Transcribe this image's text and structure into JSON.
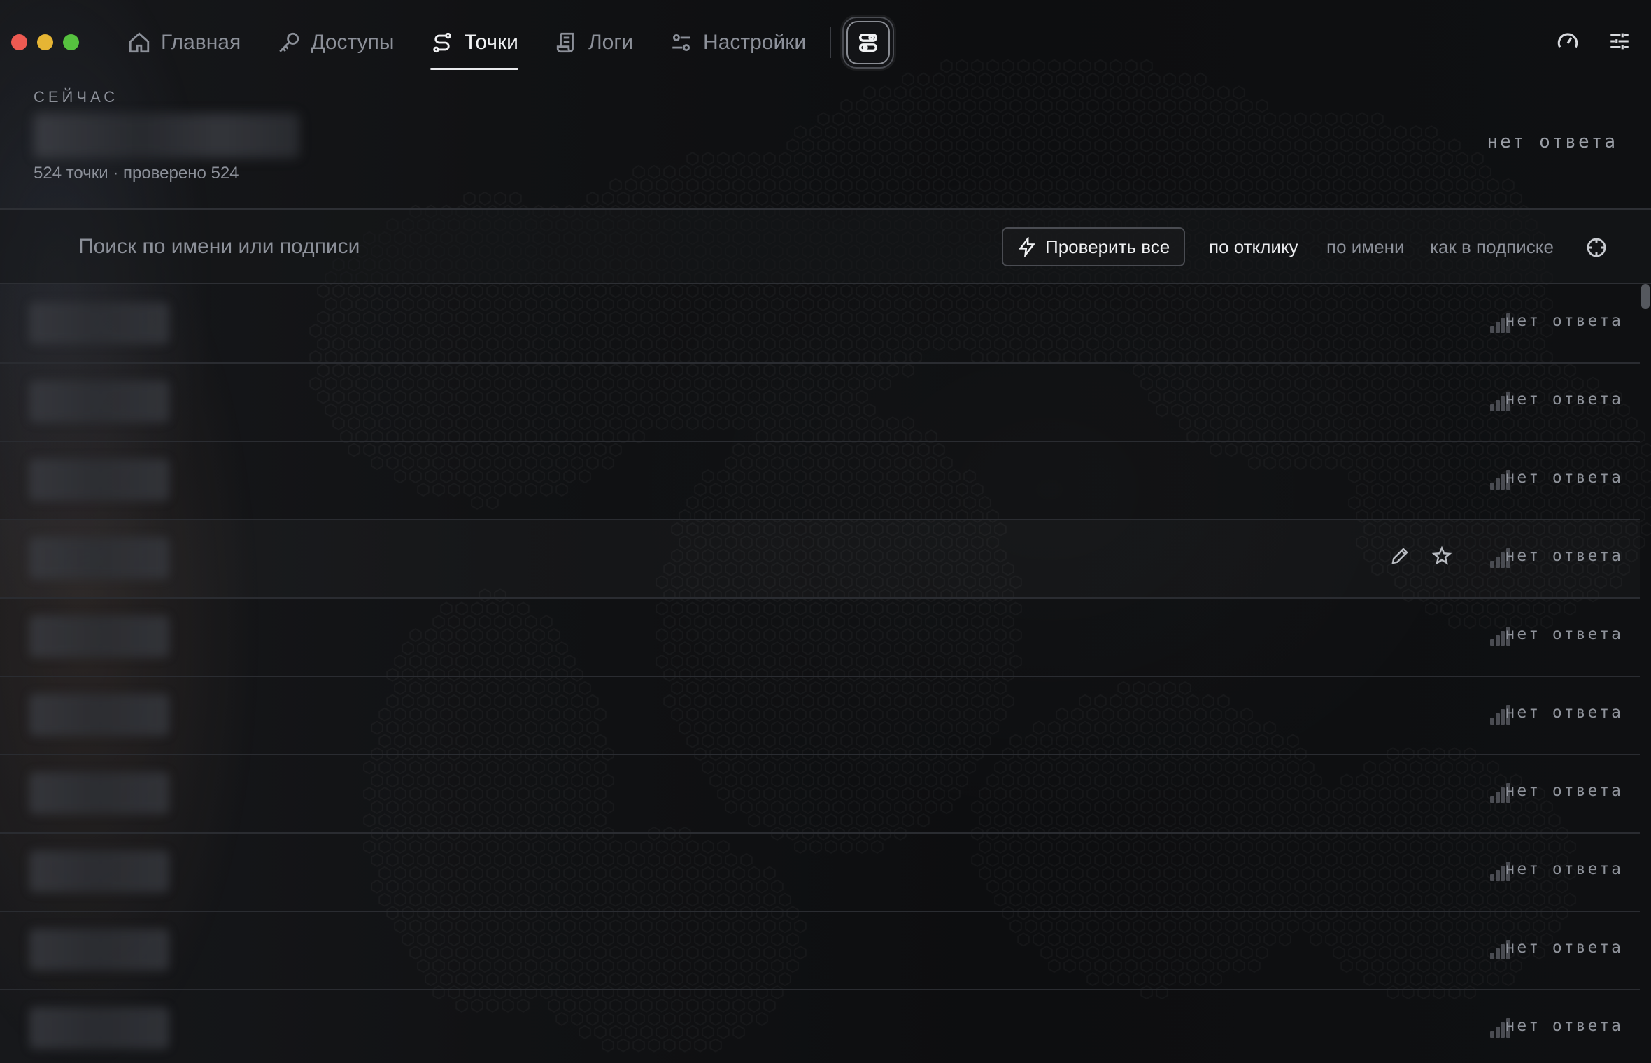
{
  "nav": {
    "items": [
      {
        "label": "Главная",
        "icon": "home-icon",
        "active": false
      },
      {
        "label": "Доступы",
        "icon": "key-icon",
        "active": false
      },
      {
        "label": "Точки",
        "icon": "route-icon",
        "active": true
      },
      {
        "label": "Логи",
        "icon": "scroll-icon",
        "active": false
      },
      {
        "label": "Настройки",
        "icon": "sliders-icon",
        "active": false
      }
    ]
  },
  "current": {
    "label": "СЕЙЧАС",
    "stats": "524 точки · проверено 524",
    "status": "нет ответа"
  },
  "search": {
    "placeholder": "Поиск по имени или подписи",
    "check_all_label": "Проверить все",
    "sort_options": [
      "по отклику",
      "по имени",
      "как в подписке"
    ],
    "active_sort": "по отклику"
  },
  "rows": [
    {
      "status": "нет ответа"
    },
    {
      "status": "нет ответа"
    },
    {
      "status": "нет ответа"
    },
    {
      "status": "нет ответа"
    },
    {
      "status": "нет ответа"
    },
    {
      "status": "нет ответа"
    },
    {
      "status": "нет ответа"
    },
    {
      "status": "нет ответа"
    },
    {
      "status": "нет ответа"
    },
    {
      "status": "нет ответа"
    }
  ],
  "colors": {
    "background": "#0f1012",
    "text_primary": "#f1f2f4",
    "text_muted": "#8c9099",
    "signal_inactive": "#4a4c52",
    "close": "#ee5a52",
    "minimize": "#e6b534",
    "zoom": "#56c13f"
  }
}
